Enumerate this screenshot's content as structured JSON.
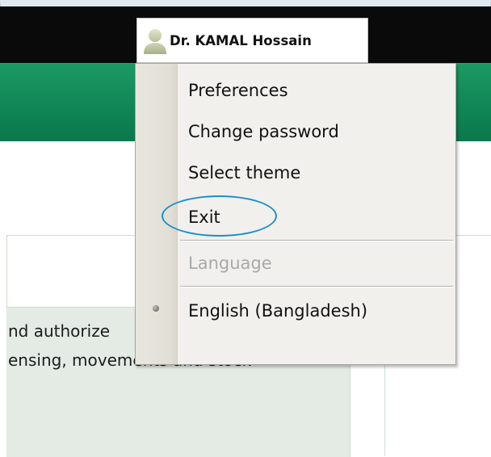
{
  "header": {
    "user_name": "Dr. KAMAL Hossain",
    "user_icon": "user-icon"
  },
  "user_menu": {
    "items": [
      {
        "label": "Preferences"
      },
      {
        "label": "Change password"
      },
      {
        "label": "Select theme"
      },
      {
        "label": "Exit",
        "highlighted": true
      }
    ],
    "language_section": {
      "label": "Language",
      "selected": "English (Bangladesh)"
    }
  },
  "main": {
    "description_lines": [
      "nd authorize",
      "ensing, movements and stock"
    ]
  },
  "colors": {
    "top_bar": "#0a0a0a",
    "brand_green": "#0f8454",
    "menu_background": "#f1f0ec",
    "panel_background": "#e3ebe4",
    "highlight_ring": "#1a8fce"
  }
}
